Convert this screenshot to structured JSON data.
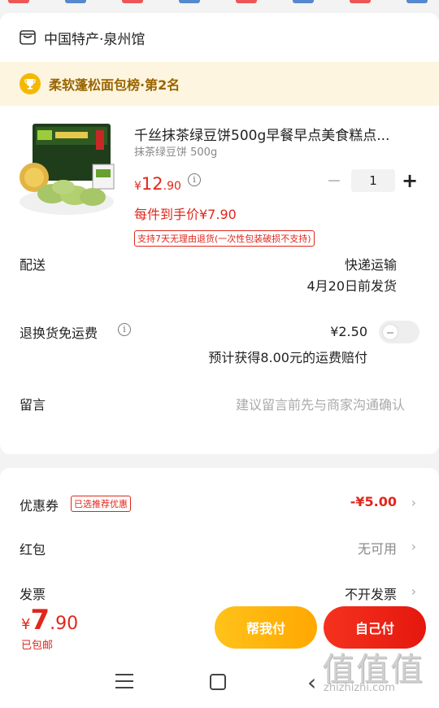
{
  "shop": {
    "name": "中国特产·泉州馆",
    "icon": "store-icon"
  },
  "rank": {
    "text": "柔软蓬松面包榜·第2名",
    "icon": "trophy-icon"
  },
  "product": {
    "title": "千丝抹茶绿豆饼500g早餐早点美食糕点...",
    "spec": "抹茶绿豆饼 500g",
    "price_currency": "¥",
    "price_int": "12",
    "price_dec": ".90",
    "final_price": "每件到手价¥7.90",
    "return_tag": "支持7天无理由退货(一次性包装破损不支持)",
    "quantity": "1",
    "minus_label": "−",
    "plus_label": "+"
  },
  "delivery": {
    "label": "配送",
    "method": "快递运输",
    "date": "4月20日前发货"
  },
  "return_shipping": {
    "label": "退换货免运费",
    "price": "¥2.50",
    "note": "预计获得8.00元的运费赔付",
    "toggle_on": false
  },
  "message": {
    "label": "留言",
    "placeholder": "建议留言前先与商家沟通确认"
  },
  "coupon": {
    "label": "优惠券",
    "badge": "已选推荐优惠",
    "value": "-¥5.00"
  },
  "redpacket": {
    "label": "红包",
    "value": "无可用"
  },
  "invoice": {
    "label": "发票",
    "value": "不开发票"
  },
  "footer": {
    "currency": "¥",
    "total_int": "7",
    "total_dec": ".90",
    "shipping_note": "已包邮",
    "help_pay_label": "帮我付",
    "self_pay_label": "自己付"
  },
  "watermark": {
    "chars": "值值值",
    "url": "zhizhizhi.com"
  },
  "colors": {
    "accent_red": "#e0271c",
    "accent_yellow": "#ffb300",
    "rank_bg": "#fdf5df"
  }
}
